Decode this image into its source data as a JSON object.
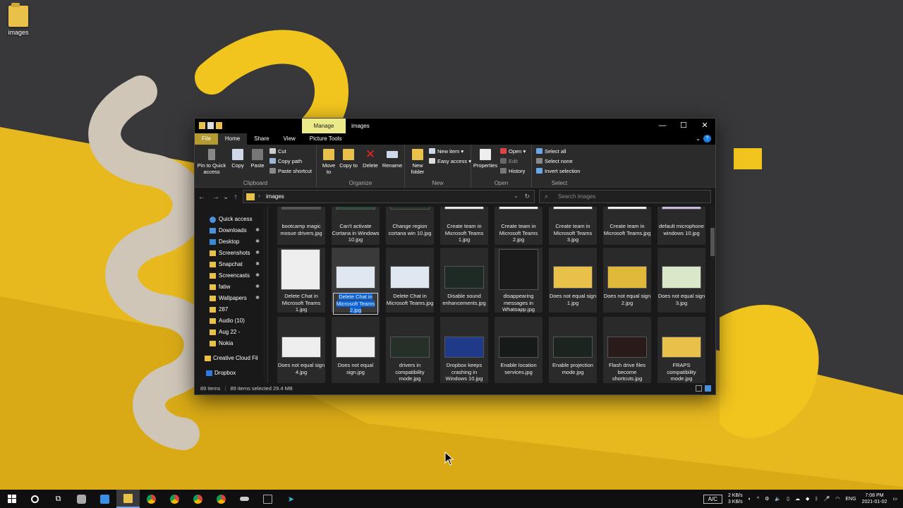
{
  "desktop": {
    "icon_label": "images"
  },
  "window": {
    "title": "images",
    "manage_label": "Manage",
    "controls": {
      "minimize": "—",
      "maximize": "☐",
      "close": "✕"
    },
    "tabs": [
      "File",
      "Home",
      "Share",
      "View",
      "Picture Tools"
    ],
    "help": "?"
  },
  "ribbon": {
    "clipboard": {
      "label": "Clipboard",
      "pin": "Pin to Quick access",
      "copy": "Copy",
      "paste": "Paste",
      "cut": "Cut",
      "copy_path": "Copy path",
      "paste_shortcut": "Paste shortcut"
    },
    "organize": {
      "label": "Organize",
      "move_to": "Move to",
      "copy_to": "Copy to",
      "delete": "Delete",
      "rename": "Rename"
    },
    "new": {
      "label": "New",
      "new_folder": "New folder",
      "new_item": "New item",
      "easy_access": "Easy access"
    },
    "open": {
      "label": "Open",
      "properties": "Properties",
      "open": "Open",
      "edit": "Edit",
      "history": "History"
    },
    "select": {
      "label": "Select",
      "select_all": "Select all",
      "select_none": "Select none",
      "invert": "Invert selection"
    }
  },
  "address": {
    "path": "images",
    "search_placeholder": "Search images"
  },
  "nav": {
    "items": [
      "Quick access",
      "Downloads",
      "Desktop",
      "Screenshots",
      "Snapchat",
      "Screencasts",
      "fatiw",
      "Wallpapers",
      "287",
      "Audio (10)",
      "Aug 22 -",
      "Nokia",
      "Creative Cloud Fil",
      "Dropbox"
    ]
  },
  "files": [
    "bootcamp magic mosue drivers.jpg",
    "Can't activate Cortana in Windows 10.jpg",
    "Change region cortana win 10.jpg",
    "Create team in Microsoft Teams 1.jpg",
    "Create team in Microsoft Teams 2.jpg",
    "Create team in Microsoft Teams 3.jpg",
    "Create team in Microsoft Teams.jpg",
    "default microphone windows 10.jpg",
    "Delete Chat in Microsoft Teams 1.jpg",
    "Delete Chat in Microsoft Teams 2.jpg",
    "Delete Chat in Microsoft Teams.jpg",
    "Disable sound enhancements.jpg",
    "disappearing messages in Whatsapp.jpg",
    "Does not equal sign 1.jpg",
    "Does not equal sign 2.jpg",
    "Does not equal sign 3.jpg",
    "Does not equal sign 4.jpg",
    "Does not equal sign.jpg",
    "drivers in compatibility mode.jpg",
    "Dropbox keeps crashing in Windows 10.jpg",
    "Enable location services.jpg",
    "Enable projection mode.jpg",
    "Flash drive files become shortcuts.jpg",
    "FRAPS compatibility mode.jpg"
  ],
  "status": {
    "count": "89 items",
    "selected": "89 items selected  29.4 MB"
  },
  "tray": {
    "ac": "A/C",
    "net_up": "2 KB/s",
    "net_down": "3 KB/s",
    "lang": "ENG",
    "time": "7:08 PM",
    "date": "2021-01-02"
  }
}
